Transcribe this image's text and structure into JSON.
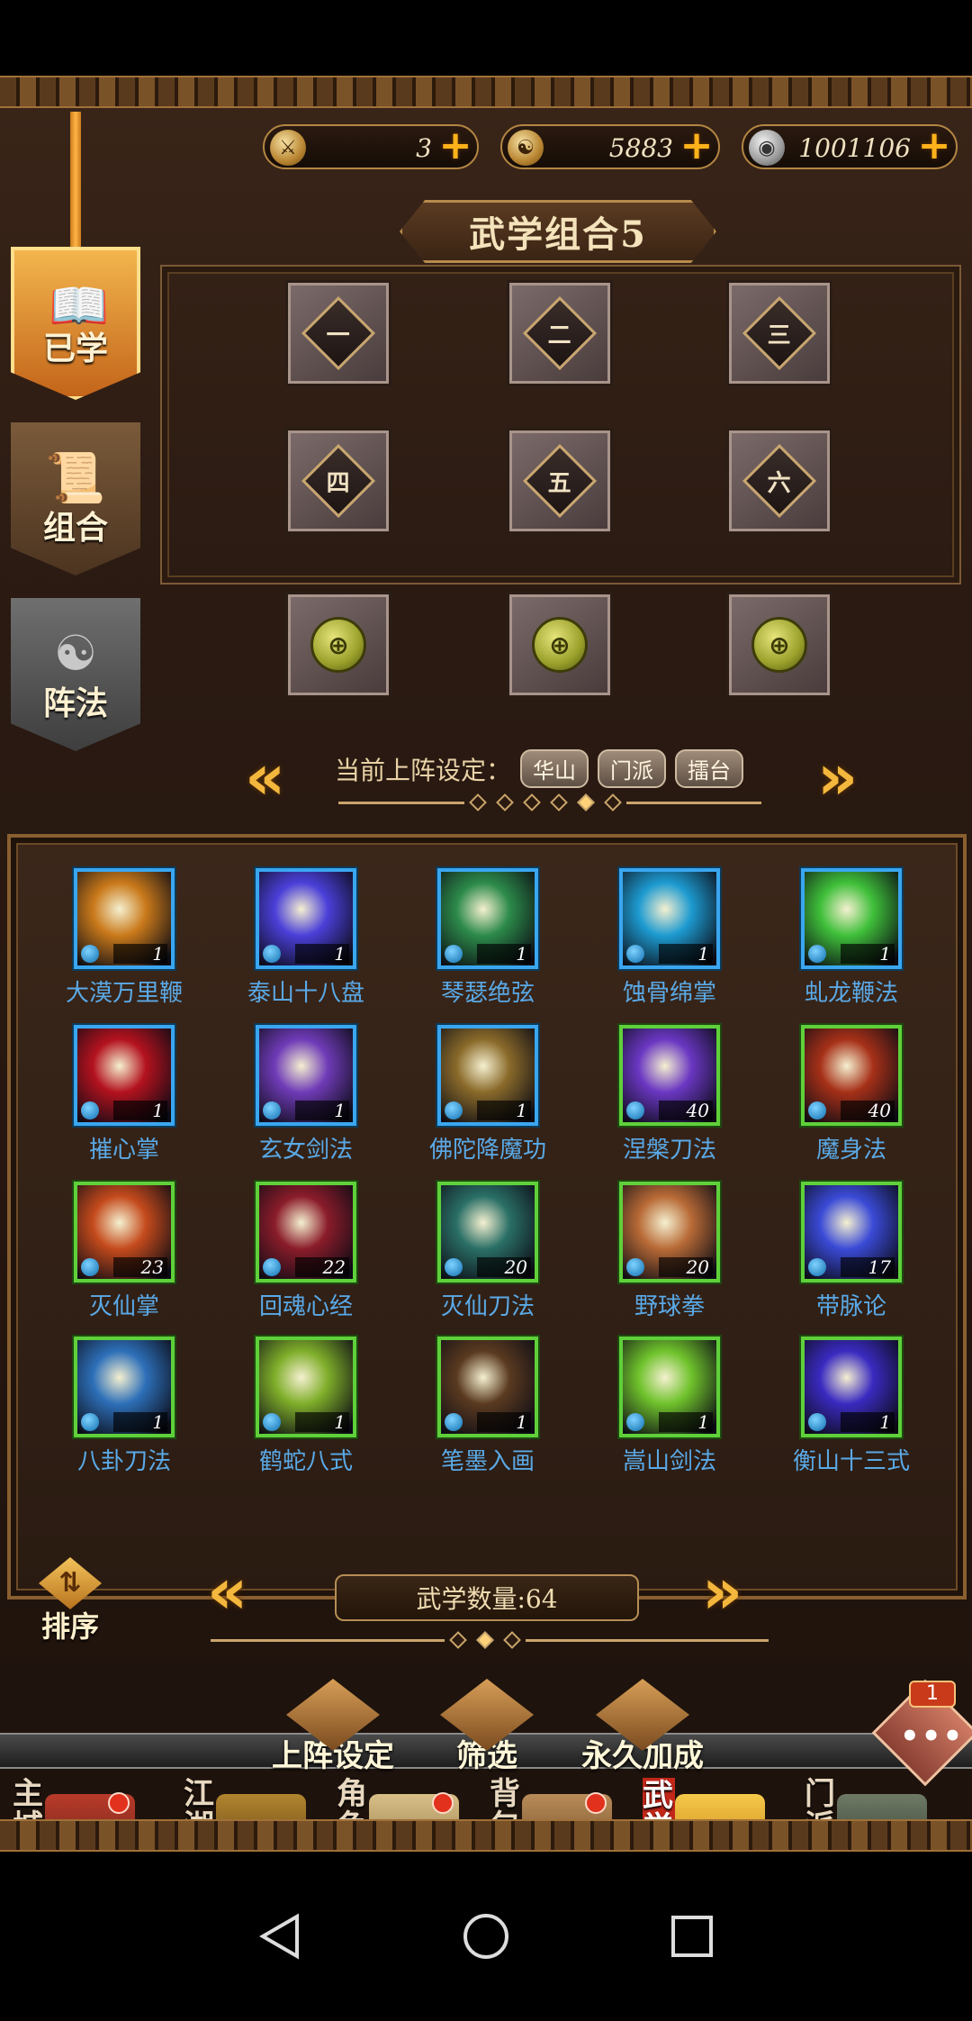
{
  "resources": [
    {
      "icon": "crossed-swords-icon",
      "value": "3"
    },
    {
      "icon": "yin-yang-coin-icon",
      "value": "5883"
    },
    {
      "icon": "silver-coin-icon",
      "value": "1001106"
    }
  ],
  "title": "武学组合5",
  "side_tabs": {
    "learned": "已学",
    "combo": "组合",
    "formation": "阵法"
  },
  "slots": {
    "row1": [
      "一",
      "二",
      "三"
    ],
    "row2": [
      "四",
      "五",
      "六"
    ]
  },
  "current_setting": {
    "label": "当前上阵设定：",
    "tags": [
      "华山",
      "门派",
      "擂台"
    ]
  },
  "skills": [
    {
      "name": "大漠万里鞭",
      "level": "1",
      "frame": "blue"
    },
    {
      "name": "泰山十八盘",
      "level": "1",
      "frame": "blue"
    },
    {
      "name": "琴瑟绝弦",
      "level": "1",
      "frame": "blue"
    },
    {
      "name": "蚀骨绵掌",
      "level": "1",
      "frame": "blue"
    },
    {
      "name": "虬龙鞭法",
      "level": "1",
      "frame": "blue"
    },
    {
      "name": "摧心掌",
      "level": "1",
      "frame": "blue"
    },
    {
      "name": "玄女剑法",
      "level": "1",
      "frame": "blue"
    },
    {
      "name": "佛陀降魔功",
      "level": "1",
      "frame": "blue"
    },
    {
      "name": "涅槃刀法",
      "level": "40",
      "frame": "green"
    },
    {
      "name": "魔身法",
      "level": "40",
      "frame": "green"
    },
    {
      "name": "灭仙掌",
      "level": "23",
      "frame": "green"
    },
    {
      "name": "回魂心经",
      "level": "22",
      "frame": "green"
    },
    {
      "name": "灭仙刀法",
      "level": "20",
      "frame": "green"
    },
    {
      "name": "野球拳",
      "level": "20",
      "frame": "green"
    },
    {
      "name": "带脉论",
      "level": "17",
      "frame": "green"
    },
    {
      "name": "八卦刀法",
      "level": "1",
      "frame": "green"
    },
    {
      "name": "鹤蛇八式",
      "level": "1",
      "frame": "green"
    },
    {
      "name": "笔墨入画",
      "level": "1",
      "frame": "green"
    },
    {
      "name": "嵩山剑法",
      "level": "1",
      "frame": "green"
    },
    {
      "name": "衡山十三式",
      "level": "1",
      "frame": "green"
    }
  ],
  "sort_label": "排序",
  "skill_count": "武学数量:64",
  "actions": {
    "deploy": "上阵设定",
    "filter": "筛选",
    "permanent_bonus": "永久加成"
  },
  "chat_count": "1",
  "nav": [
    {
      "label": "主城",
      "badge": true,
      "active": false
    },
    {
      "label": "江湖",
      "badge": false,
      "active": false
    },
    {
      "label": "角色",
      "badge": true,
      "active": false
    },
    {
      "label": "背包",
      "badge": true,
      "active": false
    },
    {
      "label": "武学",
      "badge": false,
      "active": true
    },
    {
      "label": "门派",
      "badge": false,
      "active": false
    }
  ]
}
